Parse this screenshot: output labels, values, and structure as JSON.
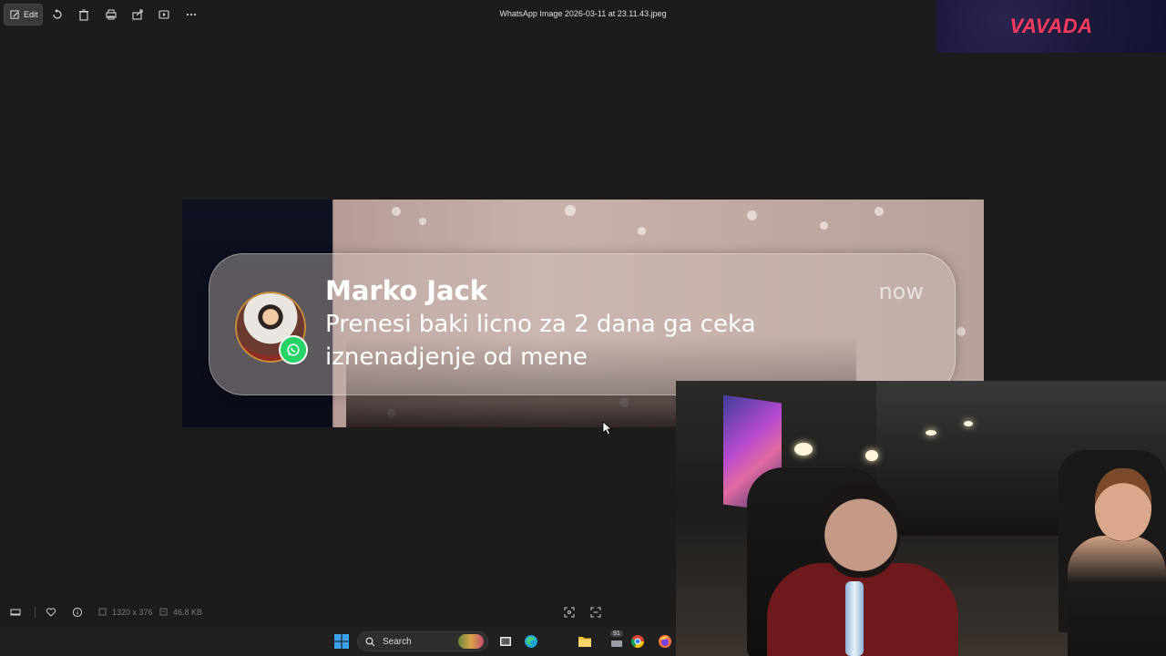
{
  "toolbar": {
    "edit_label": "Edit",
    "file_title": "WhatsApp Image 2026-03-11 at 23.11.43.jpeg",
    "icons": [
      "edit-icon",
      "rotate-icon",
      "delete-icon",
      "print-icon",
      "share-icon",
      "slideshow-icon",
      "more-icon"
    ]
  },
  "ad": {
    "brand": "VAVADA",
    "color": "#ff3b5c"
  },
  "notification": {
    "sender": "Marko Jack",
    "time": "now",
    "message": "Prenesi baki licno za 2 dana ga ceka iznenadjenje od mene",
    "app_icon": "whatsapp-icon"
  },
  "infobar": {
    "dimensions": "1320 x 376",
    "file_size": "46.8 KB",
    "icons": [
      "filmstrip-icon",
      "favorite-icon",
      "info-icon",
      "fit-icon",
      "zoom-icon"
    ]
  },
  "taskbar": {
    "search_placeholder": "Search",
    "badge": "91",
    "icons": [
      "windows-icon",
      "search-icon",
      "task-view-icon",
      "edge-icon",
      "explorer-icon",
      "app-icon",
      "chrome-icon",
      "firefox-icon"
    ]
  },
  "colors": {
    "background": "#1c1c1c",
    "toolbar_text": "#e0e0e0",
    "whatsapp_green": "#25d366",
    "taskbar": "#202020"
  }
}
